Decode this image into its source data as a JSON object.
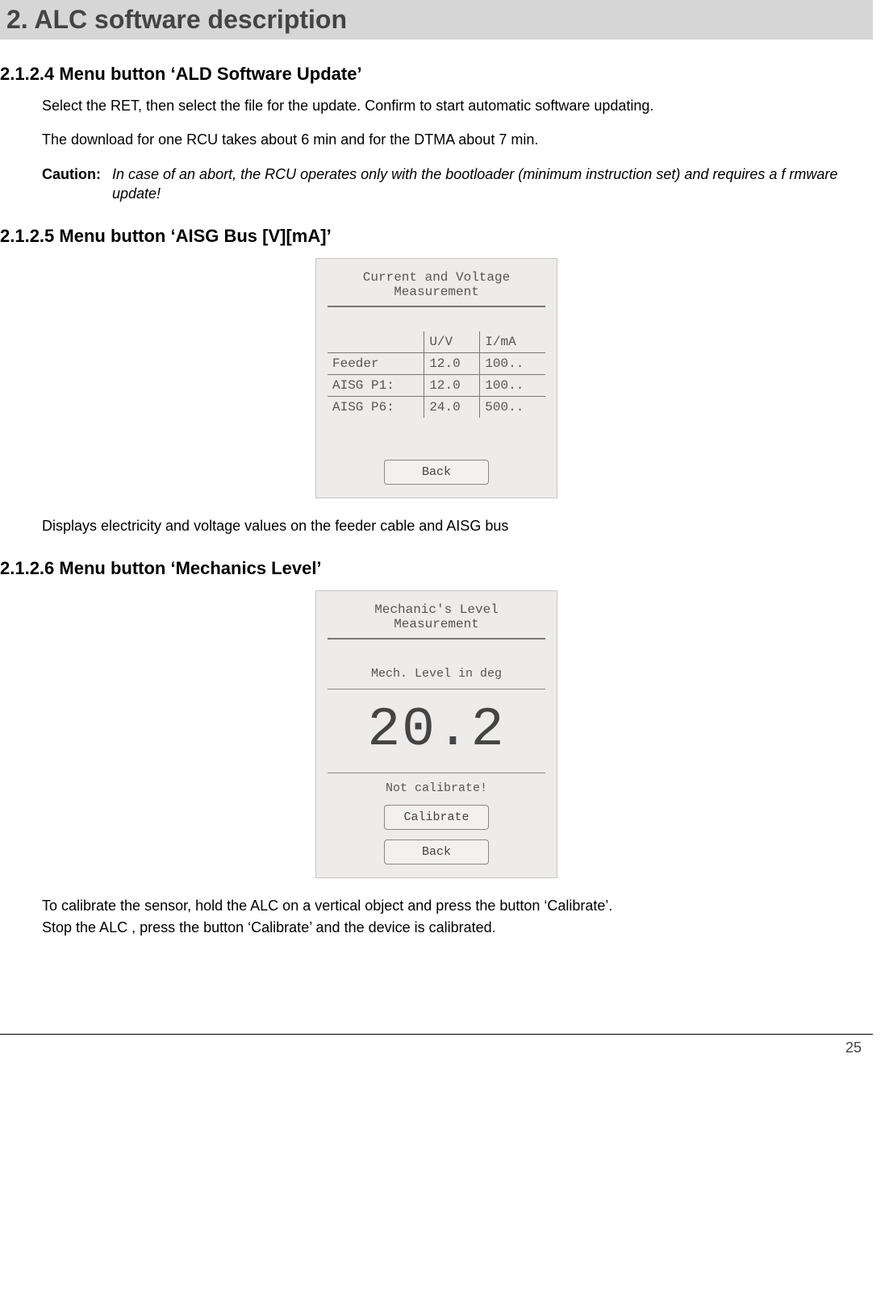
{
  "banner": "2. ALC software description",
  "sec_2124": {
    "heading": "2.1.2.4 Menu button ‘ALD Software Update’",
    "p1": "Select the RET, then select the file for the update. Confirm to start automatic software updating.",
    "p2": "The download for one RCU takes about 6 min and for the DTMA about 7 min.",
    "caution_label": "Caution:",
    "caution_text": "In case of an abort, the RCU operates only with the bootloader (minimum instruction set) and requires a f rmware update!"
  },
  "sec_2125": {
    "heading": "2.1.2.5 Menu button ‘AISG Bus [V][mA]’",
    "screen": {
      "title1": "Current and Voltage",
      "title2": "Measurement",
      "col_uv": "U/V",
      "col_ima": "I/mA",
      "rows": [
        {
          "label": "Feeder",
          "uv": "12.0",
          "ima": "100.."
        },
        {
          "label": "AISG P1:",
          "uv": "12.0",
          "ima": "100.."
        },
        {
          "label": "AISG P6:",
          "uv": "24.0",
          "ima": "500.."
        }
      ],
      "back": "Back"
    },
    "desc": "Displays electricity and voltage values on the feeder cable and AISG bus"
  },
  "sec_2126": {
    "heading": "2.1.2.6 Menu button ‘Mechanics Level’",
    "screen": {
      "title1": "Mechanic's Level",
      "title2": "Measurement",
      "mid": "Mech. Level in deg",
      "value": "20.2",
      "warn": "Not calibrate!",
      "calibrate": "Calibrate",
      "back": "Back"
    },
    "desc1": "To calibrate the sensor, hold the ALC on a vertical object and press the button ‘Calibrate’.",
    "desc2": "Stop the ALC , press the button ‘Calibrate’ and the device is calibrated."
  },
  "page_number": "25"
}
